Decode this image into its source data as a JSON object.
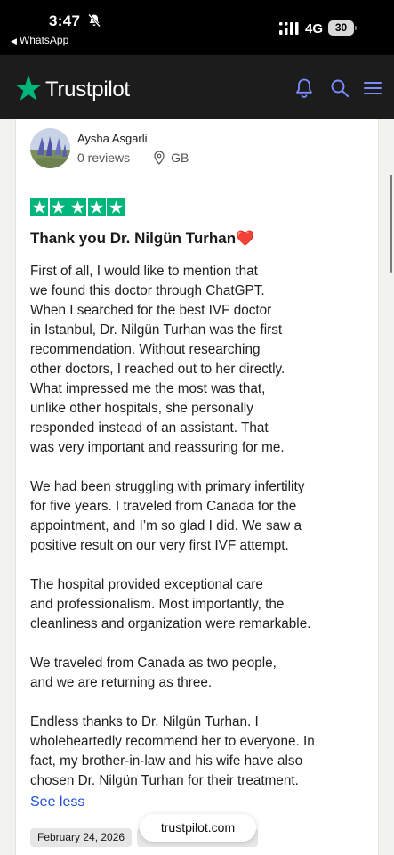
{
  "status_bar": {
    "time": "3:47",
    "back_app": "WhatsApp",
    "network": "4G",
    "battery": "30"
  },
  "nav": {
    "logo_text": "Trustpilot",
    "icons": [
      "bell-icon",
      "search-icon",
      "menu-icon"
    ],
    "brand_color": "#00b67a"
  },
  "review": {
    "reviewer_name": "Aysha Asgarli",
    "reviews_count": "0 reviews",
    "country": "GB",
    "rating": 5,
    "title": "Thank you Dr. Nilgün Turhan",
    "title_emoji": "❤️",
    "paragraphs": [
      "First of all, I would like to mention that\nwe found this doctor through ChatGPT.\nWhen I searched for the best IVF doctor\nin Istanbul, Dr. Nilgün Turhan was the first\nrecommendation. Without researching\nother doctors, I reached out to her directly.\nWhat impressed me the most was that,\nunlike other hospitals, she personally\nresponded instead of an assistant. That\nwas very important and reassuring for me.",
      "We had been struggling with primary infertility\nfor five years. I traveled from Canada for the\nappointment, and I’m so glad I did. We saw a\npositive result on our very first IVF attempt.",
      "The hospital provided exceptional care\nand professionalism. Most importantly, the\ncleanliness and organization were remarkable.",
      "We traveled from Canada as two people,\nand we are returning as three.",
      "Endless thanks to Dr. Nilgün Turhan. I\nwholeheartedly recommend her to everyone. In\nfact, my brother-in-law and his wife have also\nchosen Dr. Nilgün Turhan for their treatment."
    ],
    "see_less": "See less",
    "date": "February 24, 2026"
  },
  "browser": {
    "url": "trustpilot.com"
  }
}
